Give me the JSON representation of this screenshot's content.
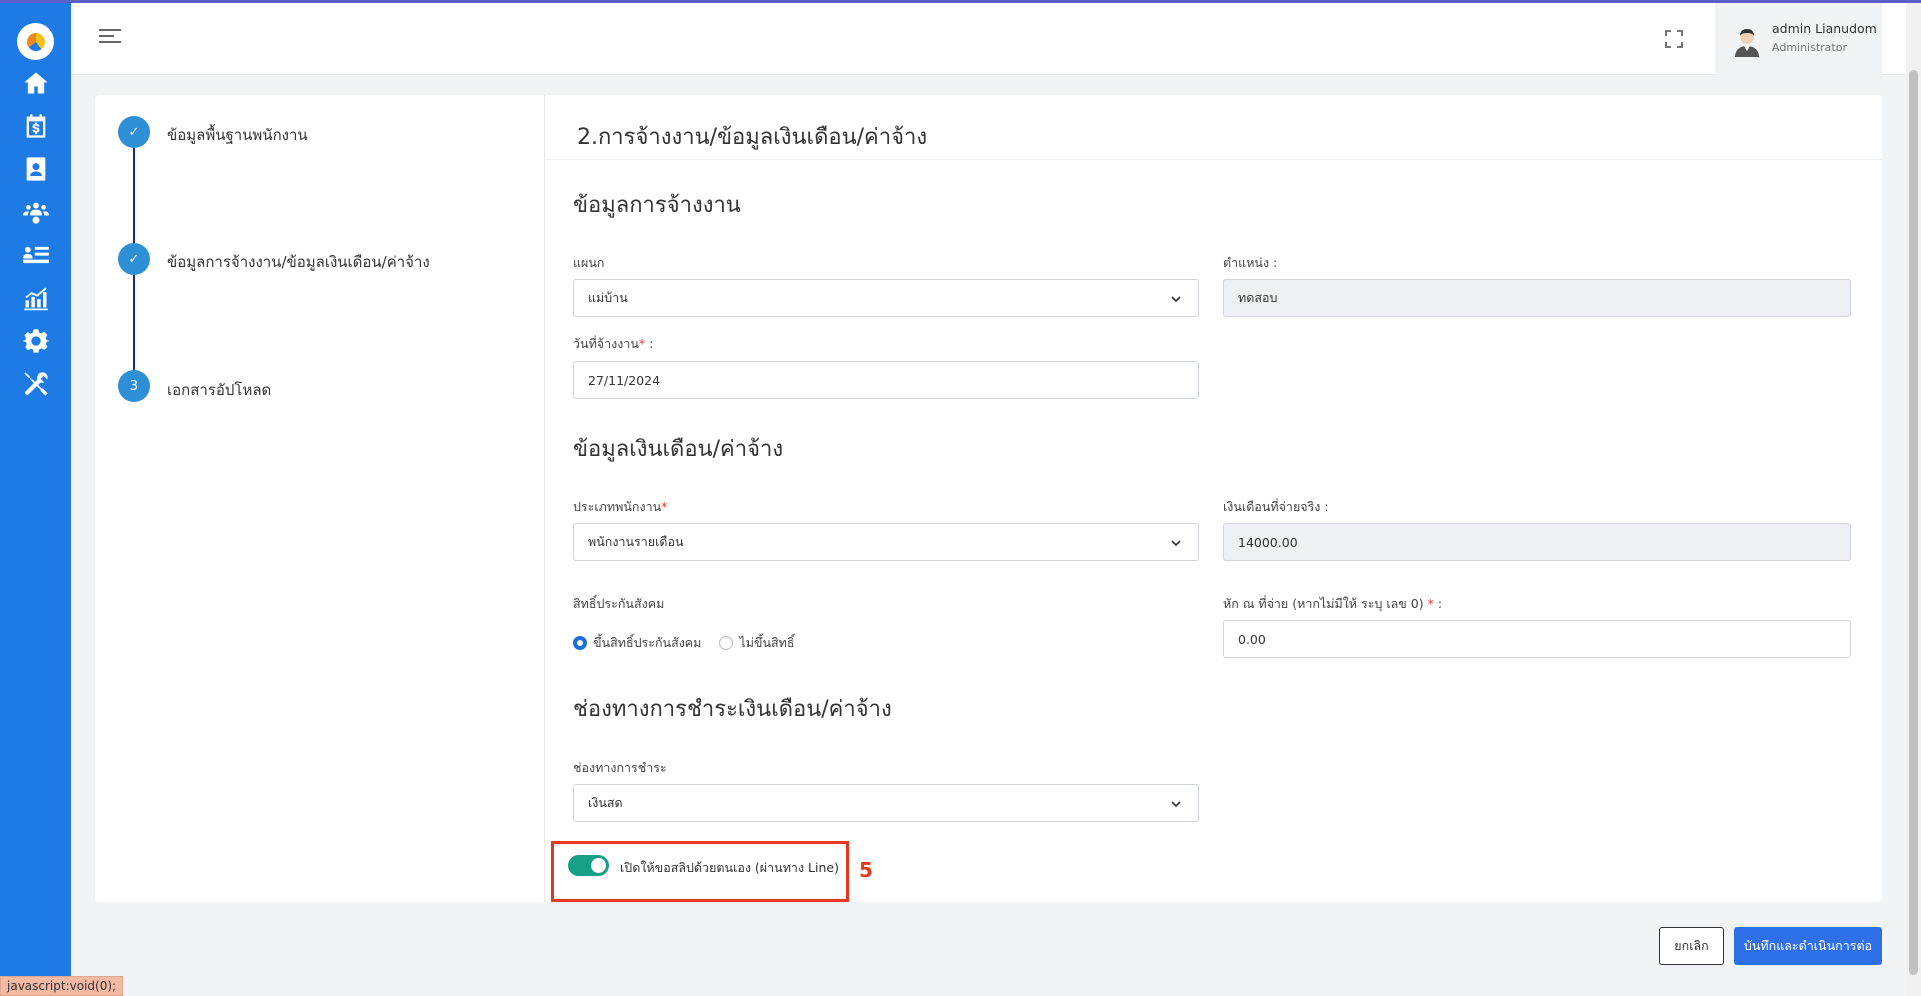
{
  "header": {
    "user_name": "admin Lianudom",
    "user_role": "Administrator"
  },
  "steps": [
    {
      "label": "ข้อมูลพื้นฐานพนักงาน",
      "marker": "✓",
      "state": "done"
    },
    {
      "label": "ข้อมูลการจ้างงาน/ข้อมูลเงินเดือน/ค่าจ้าง",
      "marker": "✓",
      "state": "done"
    },
    {
      "label": "เอกสารอัปโหลด",
      "marker": "3",
      "state": "pending"
    }
  ],
  "form": {
    "page_title": "2.การจ้างงาน/ข้อมูลเงินเดือน/ค่าจ้าง",
    "employment": {
      "section_title": "ข้อมูลการจ้างงาน",
      "department_label": "แผนก",
      "department_value": "แม่บ้าน",
      "position_label": "ตำแหน่ง :",
      "position_value": "ทดสอบ",
      "hire_date_label": "วันที่จ้างงาน",
      "hire_date_suffix": " :",
      "hire_date_value": "27/11/2024"
    },
    "salary": {
      "section_title": "ข้อมูลเงินเดือน/ค่าจ้าง",
      "employee_type_label": "ประเภทพนักงาน",
      "employee_type_value": "พนักงานรายเดือน",
      "actual_salary_label": "เงินเดือนที่จ่ายจริง :",
      "actual_salary_value": "14000.00",
      "social_security_label": "สิทธิ์ประกันสังคม",
      "social_security_options": [
        "ขึ้นสิทธิ์ประกันสังคม",
        "ไม่ขึ้นสิทธิ์"
      ],
      "social_security_selected": 0,
      "withholding_label": "หัก ณ ที่จ่าย (หากไม่มีให้ ระบุ เลข 0)",
      "withholding_suffix": " :",
      "withholding_value": "0.00"
    },
    "payment": {
      "section_title": "ช่องทางการชำระเงินเดือน/ค่าจ้าง",
      "channel_label": "ช่องทางการชำระ",
      "channel_value": "เงินสด",
      "toggle_label": "เปิดให้ขอสลิปด้วยตนเอง (ผ่านทาง Line)",
      "toggle_on": true
    },
    "annotation_number": "5"
  },
  "actions": {
    "cancel_label": "ยกเลิก",
    "save_label": "บันทึกและดำเนินการต่อ"
  },
  "status_bar_text": "javascript:void(0);",
  "colors": {
    "sidebar": "#1e7be5",
    "primary_button": "#2f6fe8",
    "toggle_on": "#16a085",
    "annotation": "#e8371f",
    "step_dot": "#2f8fd6",
    "step_line": "#1a2a8f"
  }
}
